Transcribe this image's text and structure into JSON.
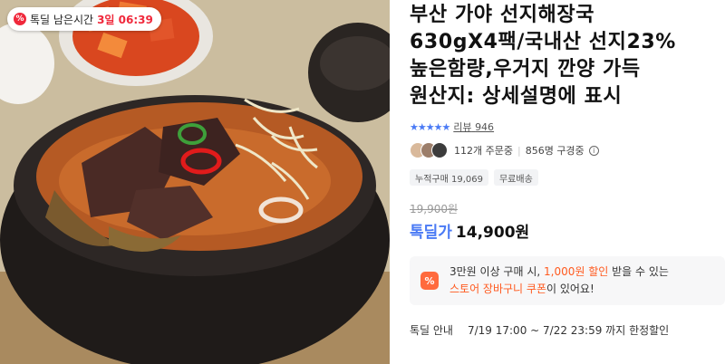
{
  "timer": {
    "icon": "percent-icon",
    "icon_glyph": "%",
    "label": "톡딜 남은시간",
    "value": "3일 06:39"
  },
  "product": {
    "title_lines": [
      "부산 가야 선지해장국",
      "630gX4팩/국내산 선지23%",
      "높은함량,우거지 깐양 가득",
      "원산지: 상세설명에 표시"
    ],
    "rating": {
      "stars_glyph": "★★★★★",
      "stars_value": 5,
      "review_label": "리뷰",
      "review_count": "946"
    },
    "orders": {
      "count_text": "112개 주문중",
      "watching_text": "856명 구경중"
    },
    "tags": [
      "누적구매 19,069",
      "무료배송"
    ],
    "price": {
      "original": "19,900원",
      "sale_label": "톡딜가",
      "sale_price": "14,900원"
    },
    "coupon": {
      "icon_glyph": "%",
      "line1_prefix": "3만원 이상 구매 시, ",
      "line1_highlight": "1,000원 할인",
      "line1_suffix": " 받을 수 있는",
      "line2_highlight": "스토어 장바구니 쿠폰",
      "line2_suffix": "이 있어요!"
    },
    "notice": {
      "label": "톡딜 안내",
      "text": "7/19 17:00 ~ 7/22 23:59 까지 한정할인"
    }
  },
  "colors": {
    "accent_blue": "#4a7af5",
    "accent_red": "#f0283b",
    "coupon_orange": "#ff5a1f"
  }
}
